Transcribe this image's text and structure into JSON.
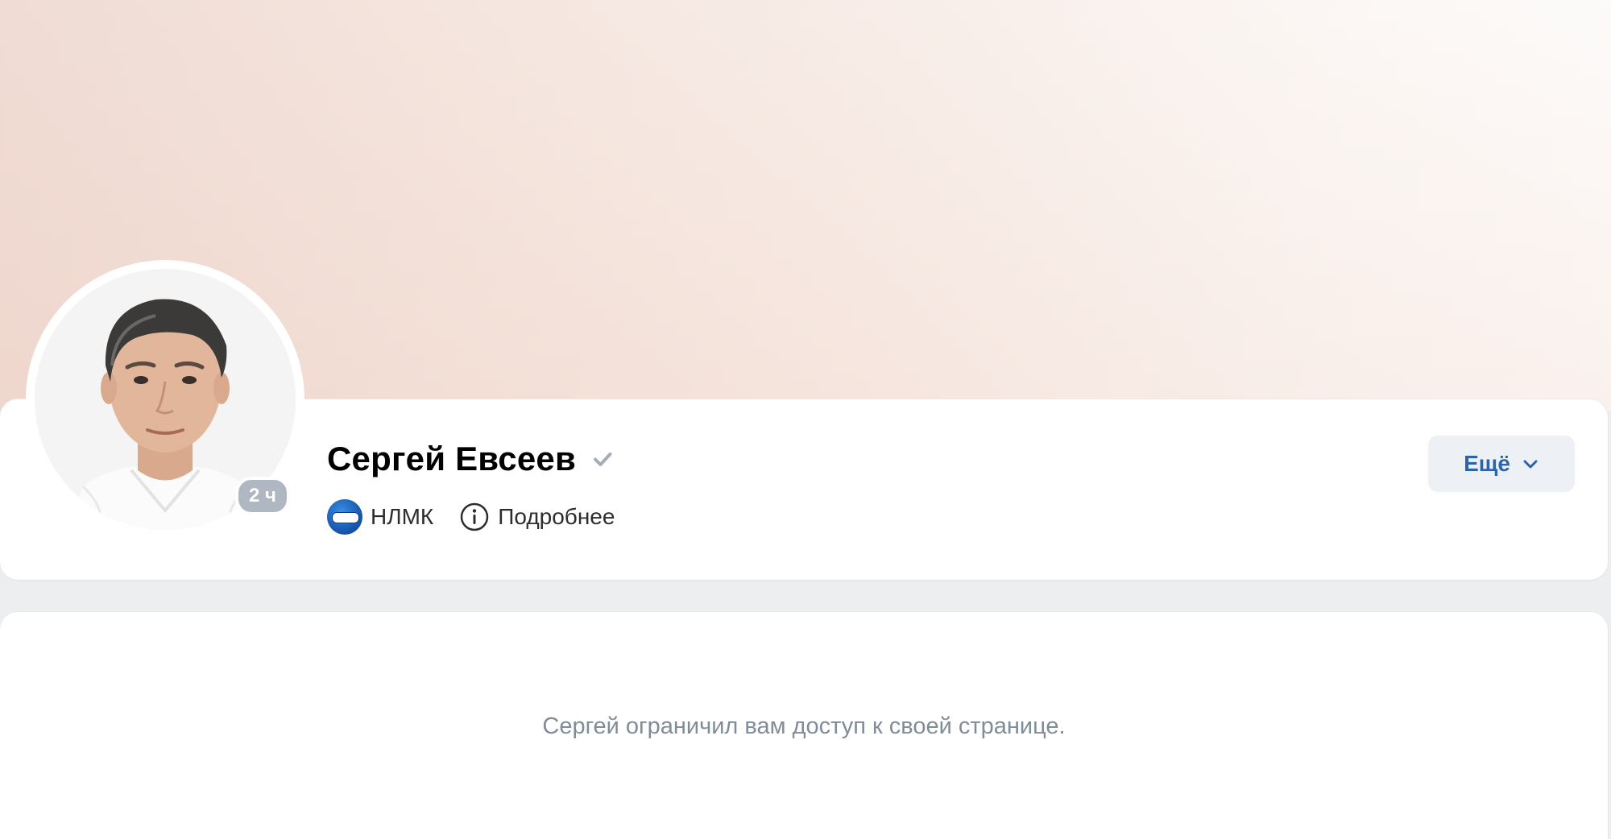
{
  "profile": {
    "name": "Сергей Евсеев",
    "verified_icon": "checkmark-icon",
    "avatar_badge": "2 ч",
    "company": "НЛМК",
    "company_logo_icon": "nlmk-logo-icon",
    "details_label": "Подробнее",
    "details_icon": "info-icon",
    "more_label": "Ещё",
    "more_icon": "chevron-down-icon"
  },
  "restricted": {
    "message": "Сергей ограничил вам доступ к своей странице."
  },
  "colors": {
    "accent": "#2d64a8",
    "page_background": "#edeef0",
    "muted_text": "#818c99",
    "badge": "#aeb7c2"
  }
}
